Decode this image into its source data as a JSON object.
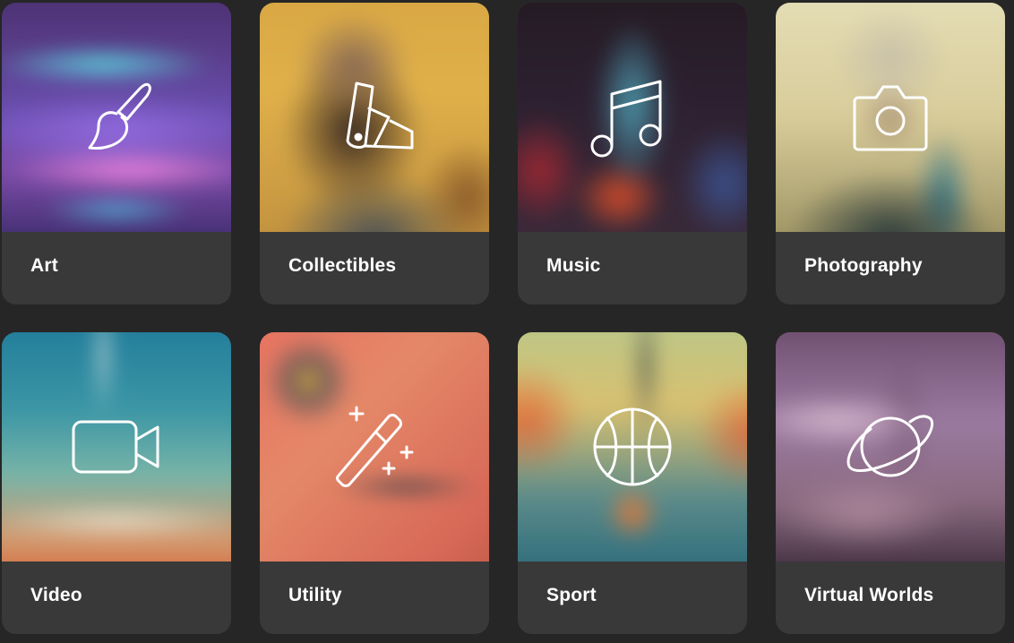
{
  "categories": [
    {
      "label": "Art",
      "icon": "paintbrush-icon"
    },
    {
      "label": "Collectibles",
      "icon": "swatch-icon"
    },
    {
      "label": "Music",
      "icon": "music-note-icon"
    },
    {
      "label": "Photography",
      "icon": "camera-icon"
    },
    {
      "label": "Video",
      "icon": "video-camera-icon"
    },
    {
      "label": "Utility",
      "icon": "magic-wand-icon"
    },
    {
      "label": "Sport",
      "icon": "basketball-icon"
    },
    {
      "label": "Virtual Worlds",
      "icon": "planet-icon"
    }
  ]
}
